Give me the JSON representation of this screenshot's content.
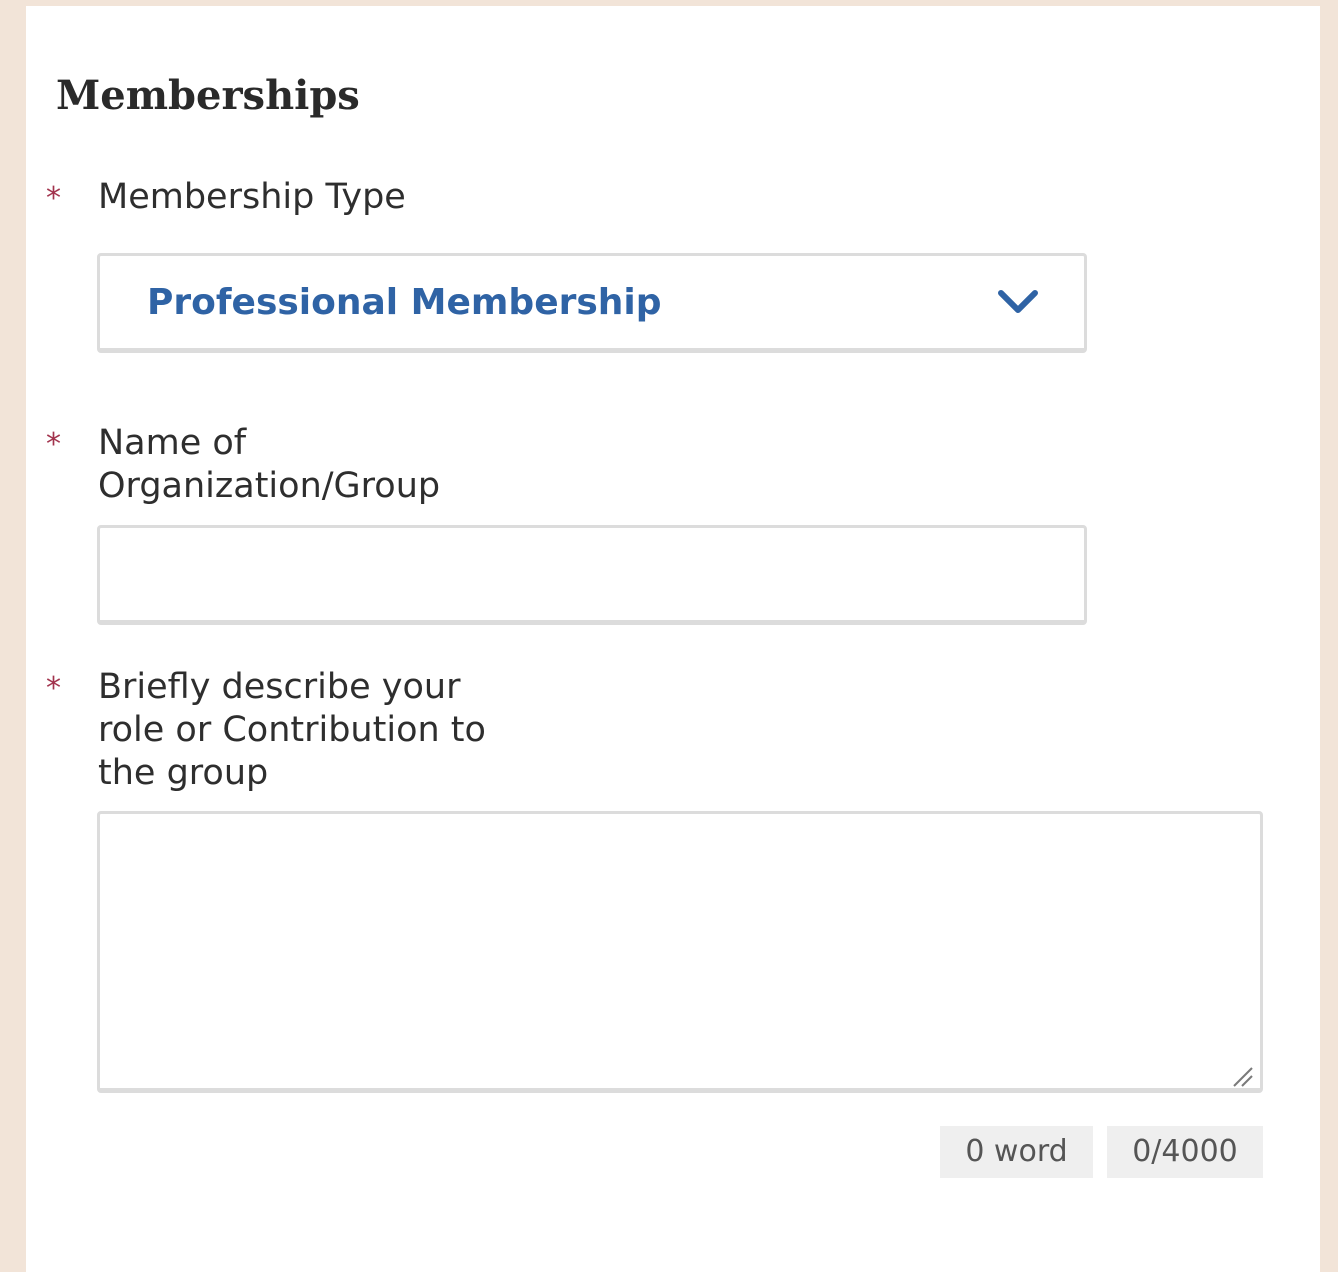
{
  "section": {
    "title": "Memberships"
  },
  "fields": {
    "membership_type": {
      "required_mark": "*",
      "label": "Membership Type",
      "selected_value": "Professional Membership"
    },
    "organization_name": {
      "required_mark": "*",
      "label_line1": "Name of",
      "label_line2": "Organization/Group",
      "value": ""
    },
    "role_description": {
      "required_mark": "*",
      "label_line1": "Briefly describe your",
      "label_line2": "role or Contribution to",
      "label_line3": "the group",
      "value": "",
      "word_count": "0 word",
      "char_count": "0/4000"
    }
  },
  "colors": {
    "page_background": "#f2e4d8",
    "required_mark": "#a2334d",
    "select_text": "#2f63a5",
    "border": "#dcdcdc"
  },
  "icons": {
    "dropdown": "chevron-down-icon",
    "resize": "resize-handle-icon"
  }
}
